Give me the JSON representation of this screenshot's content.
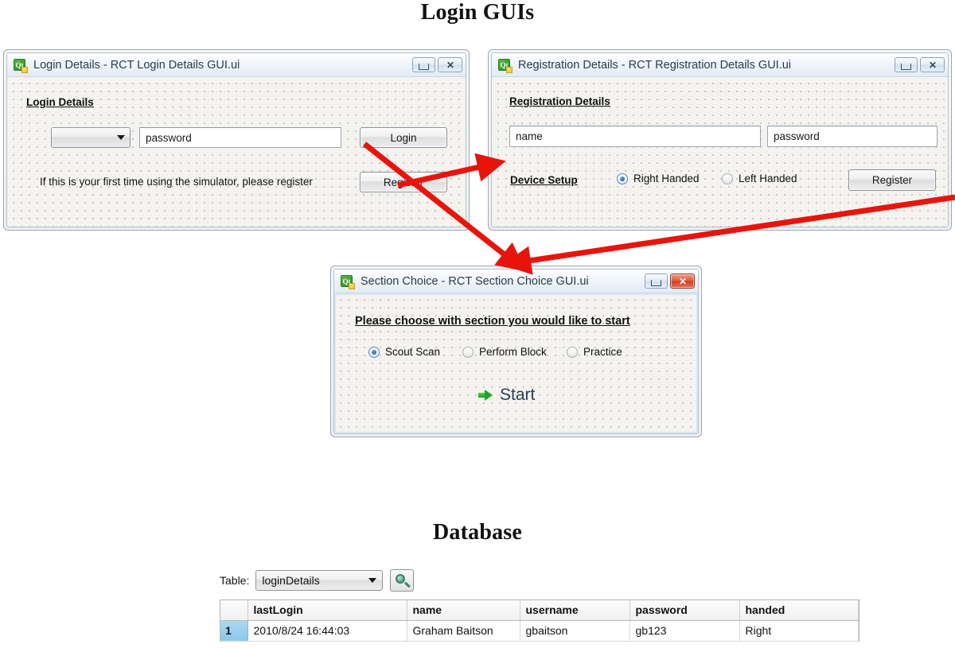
{
  "sections": {
    "login_title": "Login GUIs",
    "database_title": "Database"
  },
  "windows": {
    "login": {
      "title": "Login Details - RCT Login Details GUI.ui",
      "icon": "qt-designer-icon",
      "minimize_glyph": "",
      "close_glyph": "✕",
      "heading": "Login Details",
      "username_combo_value": "",
      "password_value": "password",
      "login_button": "Login",
      "register_hint": "If this is your first time using the simulator, please register",
      "register_button": "Register"
    },
    "registration": {
      "title": "Registration Details - RCT Registration Details GUI.ui",
      "icon": "qt-designer-icon",
      "minimize_glyph": "",
      "close_glyph": "✕",
      "heading": "Registration Details",
      "name_value": "name",
      "password_value": "password",
      "device_setup_label": "Device Setup",
      "radio_right": "Right Handed",
      "radio_left": "Left Handed",
      "selected_hand": "Right Handed",
      "register_button": "Register"
    },
    "section_choice": {
      "title": "Section Choice - RCT Section Choice GUI.ui",
      "icon": "qt-designer-icon",
      "minimize_glyph": "",
      "close_glyph": "✕",
      "heading": "Please choose with section you would like to start",
      "radio_scout": "Scout Scan",
      "radio_block": "Perform Block",
      "radio_practice": "Practice",
      "selected_section": "Scout Scan",
      "start_label": "Start"
    }
  },
  "database": {
    "table_label": "Table:",
    "table_selected": "loginDetails",
    "search_icon": "magnifier-icon",
    "columns": [
      "lastLogin",
      "name",
      "username",
      "password",
      "handed"
    ],
    "rows": [
      {
        "num": "1",
        "lastLogin": "2010/8/24 16:44:03",
        "name": "Graham Baitson",
        "username": "gbaitson",
        "password": "gb123",
        "handed": "Right"
      }
    ]
  },
  "colors": {
    "arrow": "#e8140c",
    "accent_green": "#23a327",
    "selected_row": "#8dc8ea"
  }
}
